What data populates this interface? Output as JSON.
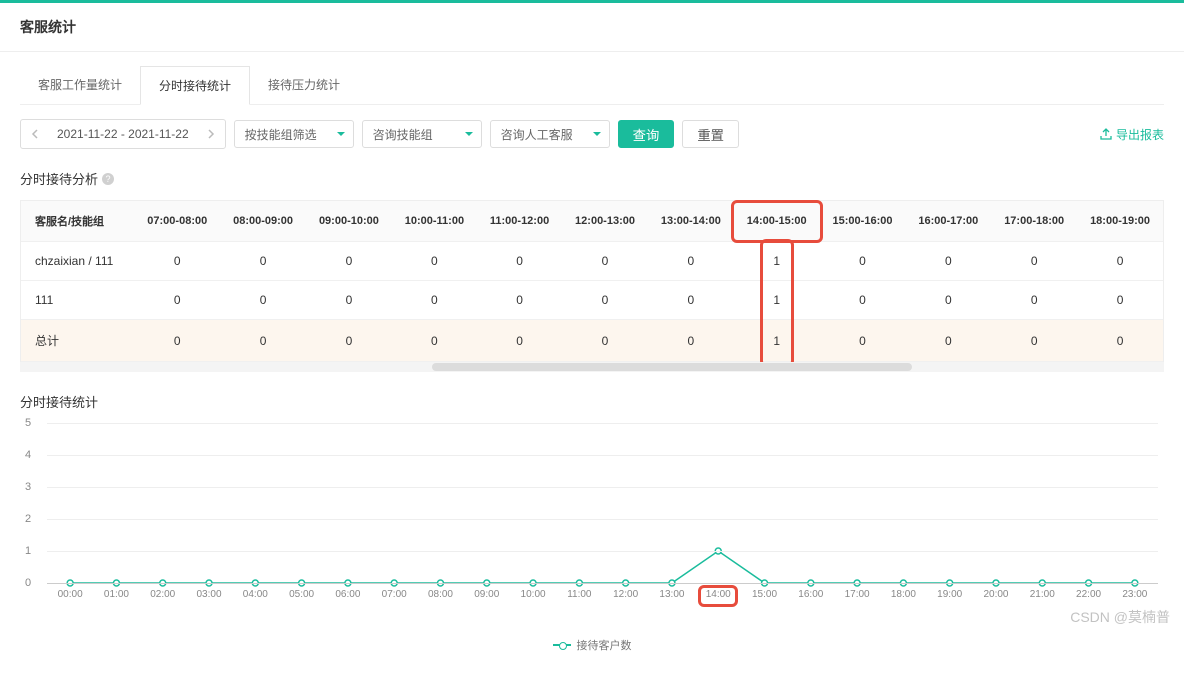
{
  "header": {
    "title": "客服统计"
  },
  "tabs": [
    {
      "label": "客服工作量统计",
      "active": false
    },
    {
      "label": "分时接待统计",
      "active": true
    },
    {
      "label": "接待压力统计",
      "active": false
    }
  ],
  "filters": {
    "date_range": "2021-11-22 - 2021-11-22",
    "skill_filter": "按技能组筛选",
    "skill_group": "咨询技能组",
    "agent": "咨询人工客服",
    "query_btn": "查询",
    "reset_btn": "重置",
    "export_label": "导出报表"
  },
  "analysis": {
    "title": "分时接待分析",
    "columns": [
      "客服名/技能组",
      "07:00-08:00",
      "08:00-09:00",
      "09:00-10:00",
      "10:00-11:00",
      "11:00-12:00",
      "12:00-13:00",
      "13:00-14:00",
      "14:00-15:00",
      "15:00-16:00",
      "16:00-17:00",
      "17:00-18:00",
      "18:00-19:00"
    ],
    "highlight_col": 8,
    "rows": [
      {
        "name": "chzaixian / 111",
        "values": [
          0,
          0,
          0,
          0,
          0,
          0,
          0,
          1,
          0,
          0,
          0,
          0
        ]
      },
      {
        "name": "111",
        "values": [
          0,
          0,
          0,
          0,
          0,
          0,
          0,
          1,
          0,
          0,
          0,
          0
        ]
      },
      {
        "name": "总计",
        "values": [
          0,
          0,
          0,
          0,
          0,
          0,
          0,
          1,
          0,
          0,
          0,
          0
        ],
        "total": true
      }
    ]
  },
  "stats_title": "分时接待统计",
  "chart_data": {
    "type": "line",
    "title": "",
    "xlabel": "",
    "ylabel": "",
    "ylim": [
      0,
      5
    ],
    "y_ticks": [
      0,
      1,
      2,
      3,
      4,
      5
    ],
    "categories": [
      "00:00",
      "01:00",
      "02:00",
      "03:00",
      "04:00",
      "05:00",
      "06:00",
      "07:00",
      "08:00",
      "09:00",
      "10:00",
      "11:00",
      "12:00",
      "13:00",
      "14:00",
      "15:00",
      "16:00",
      "17:00",
      "18:00",
      "19:00",
      "20:00",
      "21:00",
      "22:00",
      "23:00"
    ],
    "series": [
      {
        "name": "接待客户数",
        "values": [
          0,
          0,
          0,
          0,
          0,
          0,
          0,
          0,
          0,
          0,
          0,
          0,
          0,
          0,
          1,
          0,
          0,
          0,
          0,
          0,
          0,
          0,
          0,
          0
        ]
      }
    ],
    "highlight_x_index": 14
  },
  "watermark": "CSDN @莫楠普"
}
